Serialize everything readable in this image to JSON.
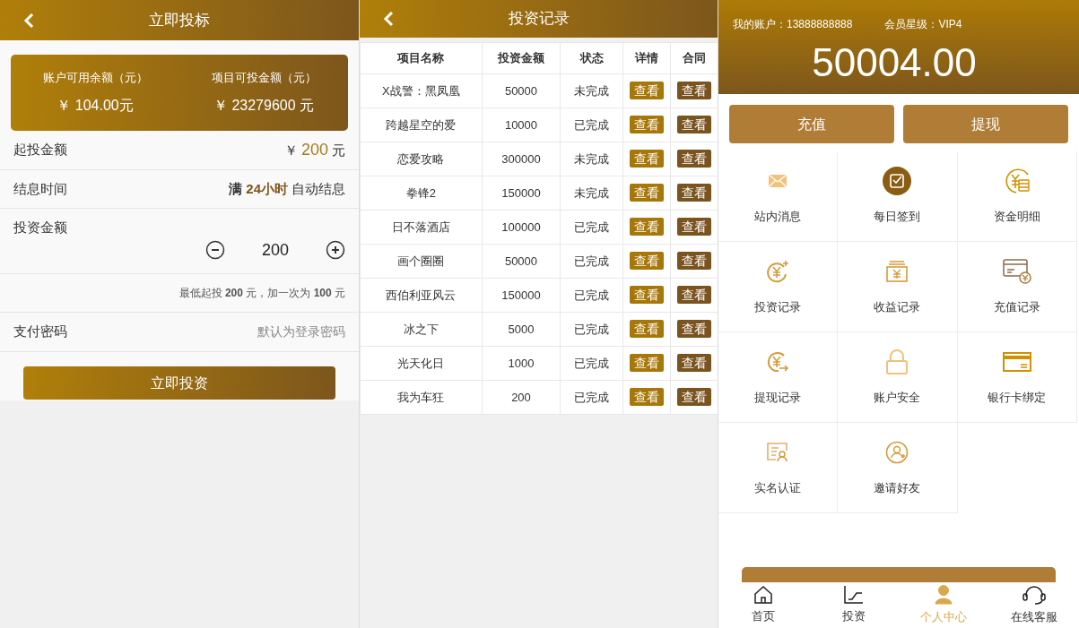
{
  "bid_page": {
    "title": "立即投标",
    "balances": [
      {
        "label": "账户可用余额（元）",
        "value": "￥ 104.00元"
      },
      {
        "label": "项目可投金额（元）",
        "value": "￥ 23279600 元"
      }
    ],
    "min_amount": {
      "label": "起投金额",
      "currency": "￥",
      "amount": "200",
      "unit": "元"
    },
    "interest_time": {
      "label": "结息时间",
      "prefix": "满",
      "highlight": "24小时",
      "suffix": "自动结息"
    },
    "invest_amount": {
      "label": "投资金额",
      "value": "200"
    },
    "hint": "最低起投 **200** 元，加一次为 **100** 元",
    "password": {
      "label": "支付密码",
      "placeholder": "默认为登录密码"
    },
    "submit": "立即投资"
  },
  "records_page": {
    "title": "投资记录",
    "columns": [
      "项目名称",
      "投资金额",
      "状态",
      "详情",
      "合同"
    ],
    "rows": [
      {
        "name": "X战警：黑凤凰",
        "amount": "50000",
        "status": "未完成",
        "detail": "查看",
        "contract": "查看"
      },
      {
        "name": "跨越星空的爱",
        "amount": "10000",
        "status": "已完成",
        "detail": "查看",
        "contract": "查看"
      },
      {
        "name": "恋爱攻略",
        "amount": "300000",
        "status": "未完成",
        "detail": "查看",
        "contract": "查看"
      },
      {
        "name": "拳锋2",
        "amount": "150000",
        "status": "未完成",
        "detail": "查看",
        "contract": "查看"
      },
      {
        "name": "日不落酒店",
        "amount": "100000",
        "status": "已完成",
        "detail": "查看",
        "contract": "查看"
      },
      {
        "name": "画个圈圈",
        "amount": "50000",
        "status": "已完成",
        "detail": "查看",
        "contract": "查看"
      },
      {
        "name": "西伯利亚风云",
        "amount": "150000",
        "status": "已完成",
        "detail": "查看",
        "contract": "查看"
      },
      {
        "name": "冰之下",
        "amount": "5000",
        "status": "已完成",
        "detail": "查看",
        "contract": "查看"
      },
      {
        "name": "光天化日",
        "amount": "1000",
        "status": "已完成",
        "detail": "查看",
        "contract": "查看"
      },
      {
        "name": "我为车狂",
        "amount": "200",
        "status": "已完成",
        "detail": "查看",
        "contract": "查看"
      }
    ]
  },
  "account_page": {
    "account": "我的账户：13888888888",
    "level": "会员星级：VIP4",
    "balance": "50004.00",
    "actions": [
      "充值",
      "提现"
    ],
    "menu": [
      {
        "kind": "mail",
        "label": "站内消息"
      },
      {
        "kind": "checkin",
        "label": "每日签到"
      },
      {
        "kind": "ledger",
        "label": "资金明细"
      },
      {
        "kind": "invest",
        "label": "投资记录"
      },
      {
        "kind": "income",
        "label": "收益记录"
      },
      {
        "kind": "recharge",
        "label": "充值记录"
      },
      {
        "kind": "withdraw",
        "label": "提现记录"
      },
      {
        "kind": "lock",
        "label": "账户安全"
      },
      {
        "kind": "card",
        "label": "银行卡绑定"
      },
      {
        "kind": "idcard",
        "label": "实名认证"
      },
      {
        "kind": "invite",
        "label": "邀请好友"
      }
    ],
    "tabs": [
      {
        "kind": "home",
        "label": "首页",
        "selected": false
      },
      {
        "kind": "chart",
        "label": "投资",
        "selected": false
      },
      {
        "kind": "user",
        "label": "个人中心",
        "selected": true
      },
      {
        "kind": "headset",
        "label": "在线客服",
        "selected": false
      }
    ]
  }
}
